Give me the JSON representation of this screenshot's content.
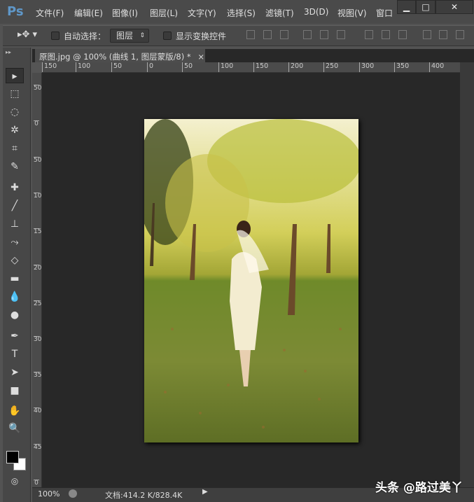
{
  "app": {
    "logo": "Ps",
    "menus": [
      "文件(F)",
      "编辑(E)",
      "图像(I)",
      "图层(L)",
      "文字(Y)",
      "选择(S)",
      "滤镜(T)",
      "3D(D)",
      "视图(V)",
      "窗口"
    ],
    "window_buttons": [
      "▁",
      "□",
      "✕"
    ]
  },
  "options": {
    "auto_select_label": "自动选择：",
    "auto_select_value": "图层",
    "show_transform_label": "显示变换控件"
  },
  "document": {
    "tab_title": "原图.jpg @ 100% (曲线 1, 图层蒙版/8) *",
    "close": "×"
  },
  "rulers": {
    "horizontal": [
      "150",
      "100",
      "50",
      "0",
      "50",
      "100",
      "150",
      "200",
      "250",
      "300",
      "350",
      "400"
    ],
    "vertical": [
      "50",
      "0",
      "50",
      "100",
      "150",
      "200",
      "250",
      "300",
      "350",
      "400",
      "450",
      "0"
    ]
  },
  "status": {
    "zoom": "100%",
    "doc_info": "文档:414.2 K/828.4K",
    "arrow": "▶"
  },
  "watermark": "头条 @路过美丫"
}
